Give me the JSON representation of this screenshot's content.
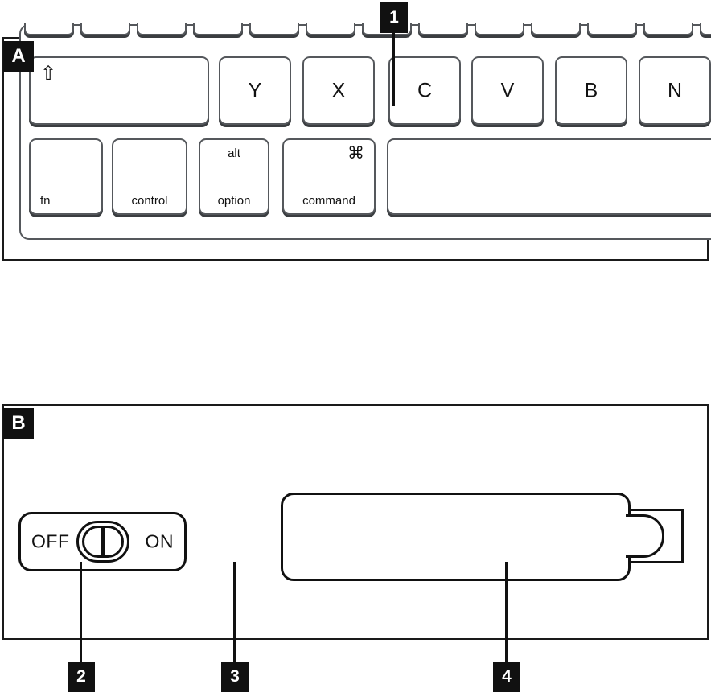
{
  "panels": [
    {
      "id": "A",
      "label": "A"
    },
    {
      "id": "B",
      "label": "B"
    }
  ],
  "callouts": [
    {
      "number": "1",
      "target": "keyboard-key-c"
    },
    {
      "number": "2",
      "target": "power-switch-toggle"
    },
    {
      "number": "3",
      "target": "device-body"
    },
    {
      "number": "4",
      "target": "battery-cover"
    }
  ],
  "panel_a": {
    "device": "keyboard",
    "letter_keys": [
      {
        "label": "Y",
        "name": "key-y"
      },
      {
        "label": "X",
        "name": "key-x"
      },
      {
        "label": "C",
        "name": "key-c"
      },
      {
        "label": "V",
        "name": "key-v"
      },
      {
        "label": "B",
        "name": "key-b"
      },
      {
        "label": "N",
        "name": "key-n"
      }
    ],
    "shift_key": {
      "glyph": "⇧",
      "icon": "shift-arrow-icon"
    },
    "modifier_keys": [
      {
        "bottom_left": "fn",
        "name": "key-fn"
      },
      {
        "bottom_center": "control",
        "name": "key-control"
      },
      {
        "top_center": "alt",
        "bottom_center": "option",
        "name": "key-alt-option"
      },
      {
        "top_right": "⌘",
        "bottom_center": "command",
        "name": "key-command"
      }
    ],
    "spacebar": {
      "label": "",
      "name": "key-space"
    }
  },
  "panel_b": {
    "power_switch": {
      "off_label": "OFF",
      "on_label": "ON",
      "state": "OFF"
    },
    "battery_cover": {
      "name": "battery-cover"
    },
    "battery_tab": {
      "name": "battery-cover-latch"
    }
  },
  "colors": {
    "line": "#111111",
    "key_outline": "#55585c",
    "key_shadow": "#3a3d40",
    "badge_bg": "#111111",
    "badge_text": "#ffffff",
    "background": "#ffffff"
  }
}
